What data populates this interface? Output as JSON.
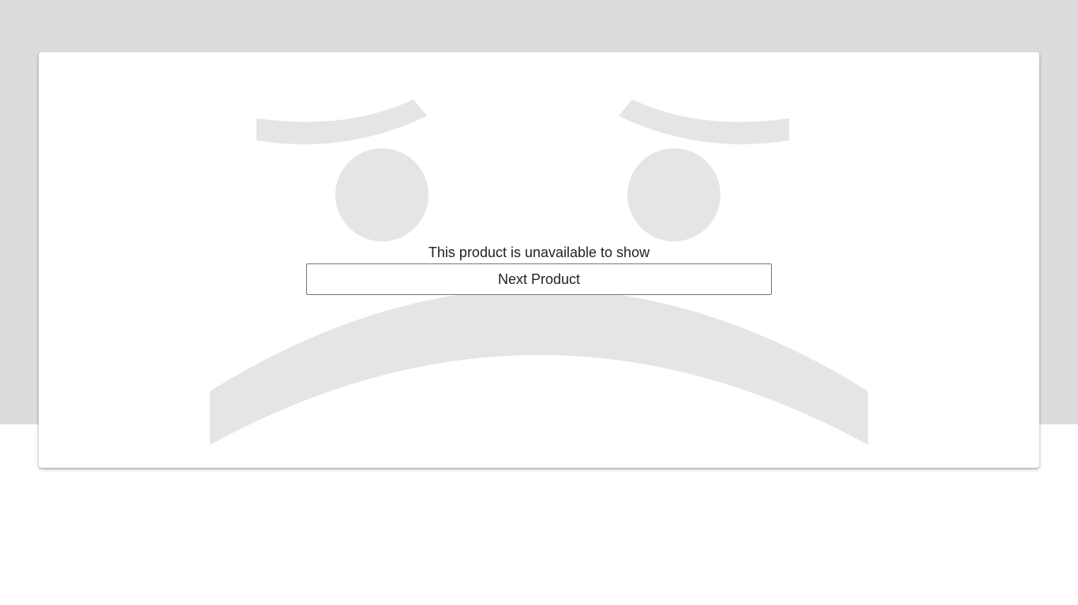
{
  "icons": {
    "background_illustration": "sad-face-icon"
  },
  "colors": {
    "page_band": "#dcdcdc",
    "card_background": "#ffffff",
    "illustration": "#e5e5e5",
    "text": "#222222",
    "button_border": "#767676"
  },
  "product": {
    "unavailable_message": "This product is unavailable to show",
    "next_button_label": "Next Product"
  }
}
